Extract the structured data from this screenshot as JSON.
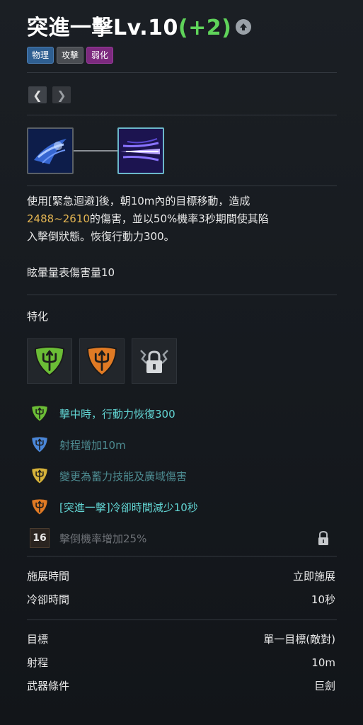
{
  "skill": {
    "name": "突進一擊Lv.10",
    "bonus": "(+2)",
    "tags": [
      {
        "label": "物理",
        "color": "#2f5f91"
      },
      {
        "label": "攻擊",
        "color": "#4a4d52"
      },
      {
        "label": "弱化",
        "color": "#7d2a7f"
      }
    ]
  },
  "nav": {
    "prev_icon": "chevron-left-icon",
    "next_icon": "chevron-right-icon"
  },
  "chain": [
    {
      "icon": "dash-claw-skill-icon"
    },
    {
      "icon": "charge-strike-skill-icon"
    }
  ],
  "description": {
    "line1": "使用[緊急迴避]後，朝10m內的目標移動，造成",
    "damage": "2488~2610",
    "line2": "的傷害，並以50%機率3秒期間使其陷",
    "line3": "入擊倒狀態。恢復行動力300。",
    "stun": "眩暈量表傷害量10"
  },
  "specialization": {
    "heading": "特化",
    "slots": [
      {
        "icon": "green-trident-shield-icon"
      },
      {
        "icon": "orange-trident-shield-icon"
      },
      {
        "icon": "padlock-icon"
      }
    ],
    "items": [
      {
        "icon": "green-trident-shield-icon",
        "text": "擊中時，行動力恢復300",
        "state": "on"
      },
      {
        "icon": "blue-trident-shield-icon",
        "text": "射程增加10m",
        "state": "off"
      },
      {
        "icon": "yellow-trident-shield-icon",
        "text": "變更為蓄力技能及廣域傷害",
        "state": "off"
      },
      {
        "icon": "orange-trident-shield-icon",
        "text": "[突進一擊]冷卻時間減少10秒",
        "state": "on"
      },
      {
        "level": "16",
        "text": "擊倒機率增加25%",
        "state": "locked",
        "lock_icon": "padlock-icon"
      }
    ]
  },
  "timing": [
    {
      "label": "施展時間",
      "value": "立即施展"
    },
    {
      "label": "冷卻時間",
      "value": "10秒"
    }
  ],
  "targeting": [
    {
      "label": "目標",
      "value": "單一目標(敵對)"
    },
    {
      "label": "射程",
      "value": "10m"
    },
    {
      "label": "武器條件",
      "value": "巨劍"
    }
  ],
  "colors": {
    "background": "#171b20",
    "bonus_green": "#5fd35a",
    "damage_gold": "#e4b552",
    "spec_active": "#62d6d4",
    "spec_inactive": "#4d8b91",
    "spec_locked": "#6e7277"
  }
}
